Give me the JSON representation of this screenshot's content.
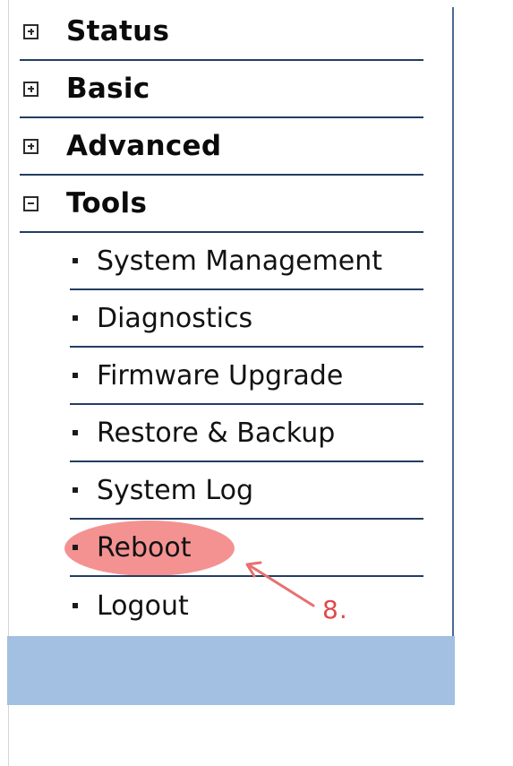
{
  "menu": {
    "sections": [
      {
        "label": "Status",
        "state": "collapsed",
        "icon": "plus-box-icon"
      },
      {
        "label": "Basic",
        "state": "collapsed",
        "icon": "plus-box-icon"
      },
      {
        "label": "Advanced",
        "state": "collapsed",
        "icon": "plus-box-icon"
      },
      {
        "label": "Tools",
        "state": "expanded",
        "icon": "minus-box-icon"
      }
    ],
    "tools_items": [
      {
        "label": "System Management"
      },
      {
        "label": "Diagnostics"
      },
      {
        "label": "Firmware Upgrade"
      },
      {
        "label": "Restore & Backup"
      },
      {
        "label": "System Log"
      },
      {
        "label": "Reboot",
        "highlighted": true
      },
      {
        "label": "Logout"
      }
    ]
  },
  "annotation": {
    "label": "8.",
    "color": "#e04848",
    "highlight_color": "#f06e6e"
  },
  "colors": {
    "divider": "#233d63",
    "panel_border": "#4a6a95",
    "footer_band": "#a3bfe2"
  }
}
